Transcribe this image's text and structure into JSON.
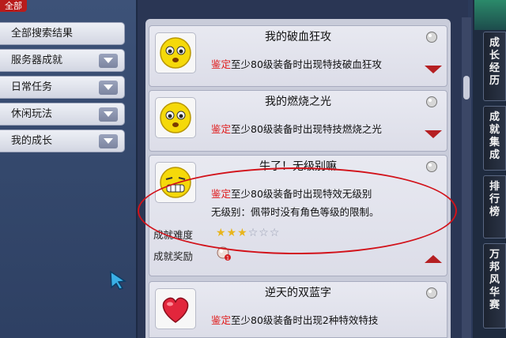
{
  "top_tab": "全部",
  "menu": [
    {
      "label": "全部搜索结果",
      "has_chevron": false
    },
    {
      "label": "服务器成就",
      "has_chevron": true
    },
    {
      "label": "日常任务",
      "has_chevron": true
    },
    {
      "label": "休闲玩法",
      "has_chevron": true
    },
    {
      "label": "我的成长",
      "has_chevron": true
    }
  ],
  "cards": [
    {
      "title": "我的破血狂攻",
      "tag": "鉴定",
      "desc": "至少80级装备时出现特技破血狂攻",
      "icon": "worried-face-icon"
    },
    {
      "title": "我的燃烧之光",
      "tag": "鉴定",
      "desc": "至少80级装备时出现特技燃烧之光",
      "icon": "worried-face-icon"
    },
    {
      "title": "牛了！无级别嘛",
      "tag": "鉴定",
      "desc": "至少80级装备时出现特效无级别",
      "note": "无级别：佩带时没有角色等级的限制。",
      "difficulty_label": "成就难度",
      "difficulty": 3,
      "difficulty_max": 6,
      "reward_label": "成就奖励",
      "icon": "grinning-face-icon"
    },
    {
      "title": "逆天的双蓝字",
      "tag": "鉴定",
      "desc": "至少80级装备时出现2种特效特技",
      "icon": "heart-icon"
    }
  ],
  "side_tabs": [
    {
      "label": "成长经历"
    },
    {
      "label": "成就集成"
    },
    {
      "label": "排行榜"
    },
    {
      "label": "万邦风华赛"
    }
  ],
  "colors": {
    "accent_red": "#e01818",
    "star": "#e8b51c",
    "oval": "#d2121a"
  }
}
